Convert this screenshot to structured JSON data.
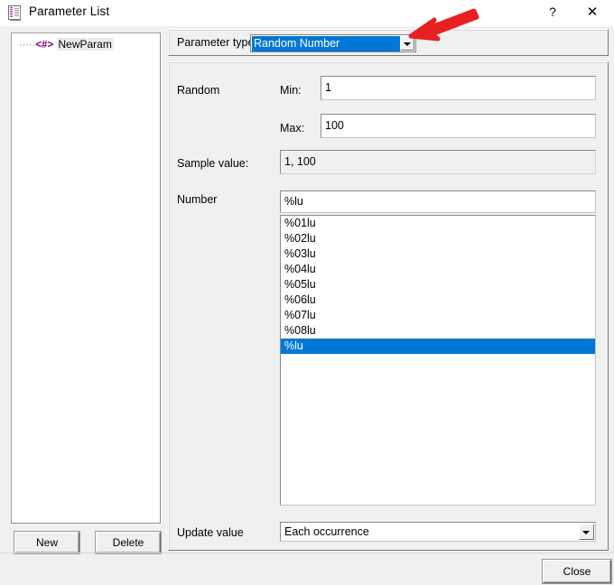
{
  "window": {
    "title": "Parameter List",
    "icon": "document-list-icon",
    "help_label": "?",
    "close_label": "✕"
  },
  "tree": {
    "items": [
      {
        "prefix": "·····",
        "glyph": "<#>",
        "label": "NewParam"
      }
    ]
  },
  "left_buttons": {
    "new_label": "New",
    "delete_label": "Delete"
  },
  "parameter_type": {
    "label": "Parameter type:",
    "value": "Random Number",
    "options": [
      "Random Number"
    ],
    "highlight_color": "#0078d7"
  },
  "random": {
    "section_label": "Random",
    "min_label": "Min:",
    "min_value": "1",
    "max_label": "Max:",
    "max_value": "100"
  },
  "sample": {
    "label": "Sample value:",
    "value": "1, 100"
  },
  "number": {
    "label": "Number",
    "field_value": "%lu",
    "options": [
      "%01lu",
      "%02lu",
      "%03lu",
      "%04lu",
      "%05lu",
      "%06lu",
      "%07lu",
      "%08lu",
      "%lu"
    ],
    "selected_index": 8,
    "selection_color": "#0078d7"
  },
  "update_value": {
    "label": "Update value",
    "value": "Each occurrence",
    "options": [
      "Each occurrence"
    ]
  },
  "dialog_buttons": {
    "close_label": "Close"
  },
  "annotation": {
    "arrow_color": "#e8201f"
  }
}
